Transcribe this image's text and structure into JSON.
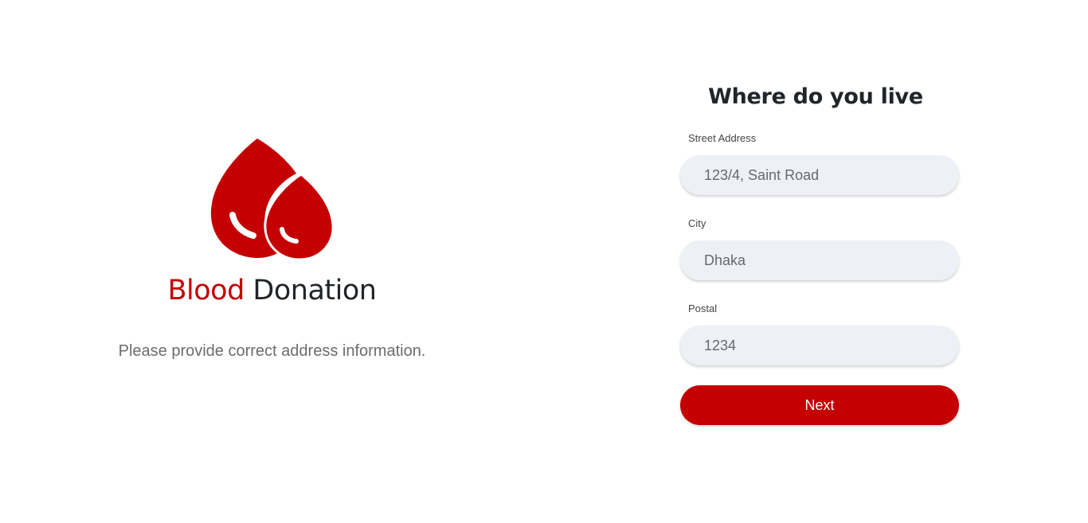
{
  "brand": {
    "logo_icon": "blood-drops-icon",
    "title_accent": "Blood",
    "title_rest": " Donation",
    "subtitle": "Please provide correct address information.",
    "accent_color": "#c40000"
  },
  "form": {
    "heading": "Where do you live",
    "fields": [
      {
        "label": "Street Address",
        "value": "123/4, Saint Road"
      },
      {
        "label": "City",
        "value": "Dhaka"
      },
      {
        "label": "Postal",
        "value": "1234"
      }
    ],
    "submit_label": "Next",
    "input_background": "#edf0f4"
  }
}
